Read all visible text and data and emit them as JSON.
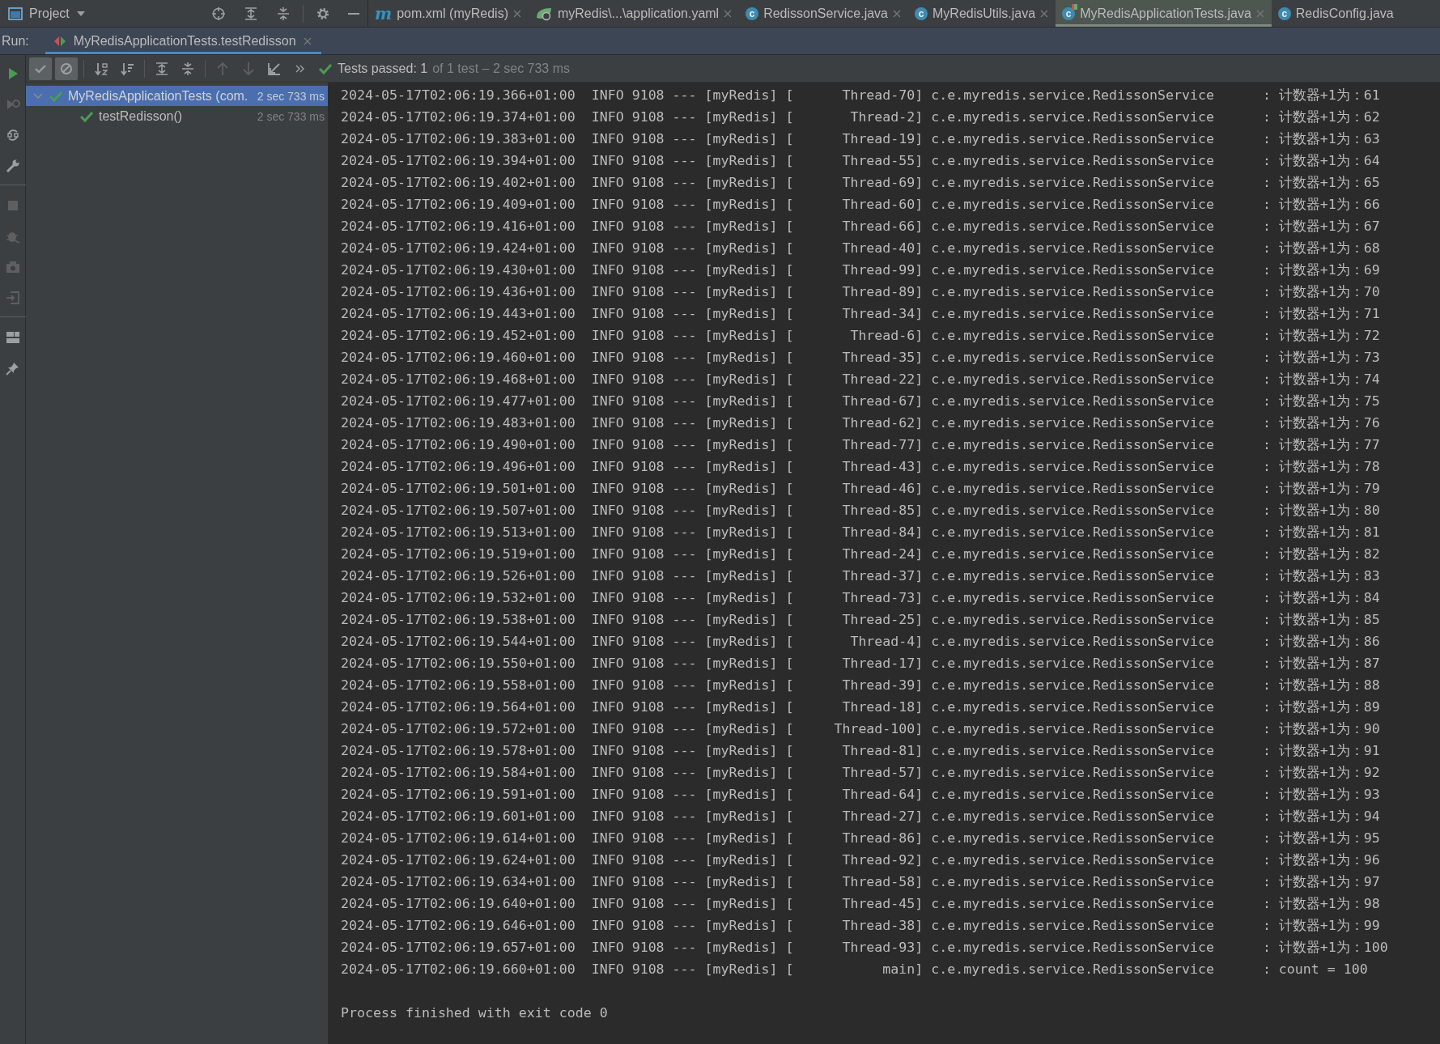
{
  "project_panel": {
    "title": "Project",
    "tools": [
      {
        "kind": "locate"
      },
      {
        "kind": "expand-all"
      },
      {
        "kind": "collapse-all"
      },
      {
        "kind": "settings"
      },
      {
        "kind": "minimize"
      }
    ]
  },
  "editor_tabs": [
    {
      "label": "pom.xml (myRedis)",
      "kind": "maven",
      "badge": "m",
      "selected": false
    },
    {
      "label": "myRedis\\...\\application.yaml",
      "kind": "spring",
      "selected": false
    },
    {
      "label": "RedissonService.java",
      "kind": "class",
      "badge": "c",
      "selected": false
    },
    {
      "label": "MyRedisUtils.java",
      "kind": "class",
      "badge": "c",
      "selected": false
    },
    {
      "label": "MyRedisApplicationTests.java",
      "kind": "test-class",
      "badge": "c",
      "selected": true
    },
    {
      "label": "RedisConfig.java",
      "kind": "class",
      "badge": "c",
      "selected": false
    }
  ],
  "run_bar": {
    "label": "Run:",
    "tab": {
      "label": "MyRedisApplicationTests.testRedisson",
      "selected": true
    }
  },
  "side_strip": [
    {
      "kind": "run",
      "disabled": false,
      "separator_before": false
    },
    {
      "kind": "rerun-failed",
      "disabled": true,
      "separator_before": false
    },
    {
      "kind": "toggle-auto",
      "disabled": false,
      "separator_before": false
    },
    {
      "kind": "wrench",
      "disabled": false,
      "separator_before": false
    },
    {
      "kind": "stop",
      "disabled": true,
      "separator_before": true
    },
    {
      "kind": "debug",
      "disabled": true,
      "separator_before": false
    },
    {
      "kind": "camera",
      "disabled": true,
      "separator_before": false
    },
    {
      "kind": "exit",
      "disabled": true,
      "separator_before": false
    },
    {
      "kind": "layout",
      "disabled": false,
      "separator_before": true
    },
    {
      "kind": "pin",
      "disabled": false,
      "separator_before": false
    }
  ],
  "toolbar": {
    "buttons": [
      {
        "kind": "show-passed",
        "selected": true,
        "disabled": false
      },
      {
        "kind": "show-ignored",
        "selected": true,
        "disabled": false
      },
      {
        "kind": "sort-alpha",
        "selected": false,
        "disabled": false
      },
      {
        "kind": "sort-duration",
        "selected": false,
        "disabled": false
      },
      {
        "kind": "expand-all",
        "selected": false,
        "disabled": false
      },
      {
        "kind": "collapse-all",
        "selected": false,
        "disabled": false
      },
      {
        "kind": "previous",
        "selected": false,
        "disabled": true
      },
      {
        "kind": "next",
        "selected": false,
        "disabled": true
      },
      {
        "kind": "import",
        "selected": false,
        "disabled": false
      },
      {
        "kind": "more",
        "selected": false,
        "disabled": false
      }
    ],
    "status": {
      "passed": true,
      "summary": "Tests passed: 1",
      "detail": "of 1 test – 2 sec 733 ms"
    }
  },
  "test_tree": [
    {
      "label": "MyRedisApplicationTests (com.",
      "duration": "2 sec 733 ms",
      "passed": true,
      "expanded": true,
      "selected": true,
      "children": [
        {
          "label": "testRedisson()",
          "duration": "2 sec 733 ms",
          "passed": true,
          "selected": false
        }
      ]
    }
  ],
  "console": {
    "lines": [
      "2024-05-17T02:06:19.366+01:00  INFO 9108 --- [myRedis] [      Thread-70] c.e.myredis.service.RedissonService      : 计数器+1为：61",
      "2024-05-17T02:06:19.374+01:00  INFO 9108 --- [myRedis] [       Thread-2] c.e.myredis.service.RedissonService      : 计数器+1为：62",
      "2024-05-17T02:06:19.383+01:00  INFO 9108 --- [myRedis] [      Thread-19] c.e.myredis.service.RedissonService      : 计数器+1为：63",
      "2024-05-17T02:06:19.394+01:00  INFO 9108 --- [myRedis] [      Thread-55] c.e.myredis.service.RedissonService      : 计数器+1为：64",
      "2024-05-17T02:06:19.402+01:00  INFO 9108 --- [myRedis] [      Thread-69] c.e.myredis.service.RedissonService      : 计数器+1为：65",
      "2024-05-17T02:06:19.409+01:00  INFO 9108 --- [myRedis] [      Thread-60] c.e.myredis.service.RedissonService      : 计数器+1为：66",
      "2024-05-17T02:06:19.416+01:00  INFO 9108 --- [myRedis] [      Thread-66] c.e.myredis.service.RedissonService      : 计数器+1为：67",
      "2024-05-17T02:06:19.424+01:00  INFO 9108 --- [myRedis] [      Thread-40] c.e.myredis.service.RedissonService      : 计数器+1为：68",
      "2024-05-17T02:06:19.430+01:00  INFO 9108 --- [myRedis] [      Thread-99] c.e.myredis.service.RedissonService      : 计数器+1为：69",
      "2024-05-17T02:06:19.436+01:00  INFO 9108 --- [myRedis] [      Thread-89] c.e.myredis.service.RedissonService      : 计数器+1为：70",
      "2024-05-17T02:06:19.443+01:00  INFO 9108 --- [myRedis] [      Thread-34] c.e.myredis.service.RedissonService      : 计数器+1为：71",
      "2024-05-17T02:06:19.452+01:00  INFO 9108 --- [myRedis] [       Thread-6] c.e.myredis.service.RedissonService      : 计数器+1为：72",
      "2024-05-17T02:06:19.460+01:00  INFO 9108 --- [myRedis] [      Thread-35] c.e.myredis.service.RedissonService      : 计数器+1为：73",
      "2024-05-17T02:06:19.468+01:00  INFO 9108 --- [myRedis] [      Thread-22] c.e.myredis.service.RedissonService      : 计数器+1为：74",
      "2024-05-17T02:06:19.477+01:00  INFO 9108 --- [myRedis] [      Thread-67] c.e.myredis.service.RedissonService      : 计数器+1为：75",
      "2024-05-17T02:06:19.483+01:00  INFO 9108 --- [myRedis] [      Thread-62] c.e.myredis.service.RedissonService      : 计数器+1为：76",
      "2024-05-17T02:06:19.490+01:00  INFO 9108 --- [myRedis] [      Thread-77] c.e.myredis.service.RedissonService      : 计数器+1为：77",
      "2024-05-17T02:06:19.496+01:00  INFO 9108 --- [myRedis] [      Thread-43] c.e.myredis.service.RedissonService      : 计数器+1为：78",
      "2024-05-17T02:06:19.501+01:00  INFO 9108 --- [myRedis] [      Thread-46] c.e.myredis.service.RedissonService      : 计数器+1为：79",
      "2024-05-17T02:06:19.507+01:00  INFO 9108 --- [myRedis] [      Thread-85] c.e.myredis.service.RedissonService      : 计数器+1为：80",
      "2024-05-17T02:06:19.513+01:00  INFO 9108 --- [myRedis] [      Thread-84] c.e.myredis.service.RedissonService      : 计数器+1为：81",
      "2024-05-17T02:06:19.519+01:00  INFO 9108 --- [myRedis] [      Thread-24] c.e.myredis.service.RedissonService      : 计数器+1为：82",
      "2024-05-17T02:06:19.526+01:00  INFO 9108 --- [myRedis] [      Thread-37] c.e.myredis.service.RedissonService      : 计数器+1为：83",
      "2024-05-17T02:06:19.532+01:00  INFO 9108 --- [myRedis] [      Thread-73] c.e.myredis.service.RedissonService      : 计数器+1为：84",
      "2024-05-17T02:06:19.538+01:00  INFO 9108 --- [myRedis] [      Thread-25] c.e.myredis.service.RedissonService      : 计数器+1为：85",
      "2024-05-17T02:06:19.544+01:00  INFO 9108 --- [myRedis] [       Thread-4] c.e.myredis.service.RedissonService      : 计数器+1为：86",
      "2024-05-17T02:06:19.550+01:00  INFO 9108 --- [myRedis] [      Thread-17] c.e.myredis.service.RedissonService      : 计数器+1为：87",
      "2024-05-17T02:06:19.558+01:00  INFO 9108 --- [myRedis] [      Thread-39] c.e.myredis.service.RedissonService      : 计数器+1为：88",
      "2024-05-17T02:06:19.564+01:00  INFO 9108 --- [myRedis] [      Thread-18] c.e.myredis.service.RedissonService      : 计数器+1为：89",
      "2024-05-17T02:06:19.572+01:00  INFO 9108 --- [myRedis] [     Thread-100] c.e.myredis.service.RedissonService      : 计数器+1为：90",
      "2024-05-17T02:06:19.578+01:00  INFO 9108 --- [myRedis] [      Thread-81] c.e.myredis.service.RedissonService      : 计数器+1为：91",
      "2024-05-17T02:06:19.584+01:00  INFO 9108 --- [myRedis] [      Thread-57] c.e.myredis.service.RedissonService      : 计数器+1为：92",
      "2024-05-17T02:06:19.591+01:00  INFO 9108 --- [myRedis] [      Thread-64] c.e.myredis.service.RedissonService      : 计数器+1为：93",
      "2024-05-17T02:06:19.601+01:00  INFO 9108 --- [myRedis] [      Thread-27] c.e.myredis.service.RedissonService      : 计数器+1为：94",
      "2024-05-17T02:06:19.614+01:00  INFO 9108 --- [myRedis] [      Thread-86] c.e.myredis.service.RedissonService      : 计数器+1为：95",
      "2024-05-17T02:06:19.624+01:00  INFO 9108 --- [myRedis] [      Thread-92] c.e.myredis.service.RedissonService      : 计数器+1为：96",
      "2024-05-17T02:06:19.634+01:00  INFO 9108 --- [myRedis] [      Thread-58] c.e.myredis.service.RedissonService      : 计数器+1为：97",
      "2024-05-17T02:06:19.640+01:00  INFO 9108 --- [myRedis] [      Thread-45] c.e.myredis.service.RedissonService      : 计数器+1为：98",
      "2024-05-17T02:06:19.646+01:00  INFO 9108 --- [myRedis] [      Thread-38] c.e.myredis.service.RedissonService      : 计数器+1为：99",
      "2024-05-17T02:06:19.657+01:00  INFO 9108 --- [myRedis] [      Thread-93] c.e.myredis.service.RedissonService      : 计数器+1为：100",
      "2024-05-17T02:06:19.660+01:00  INFO 9108 --- [myRedis] [           main] c.e.myredis.service.RedissonService      : count = 100"
    ],
    "footer": "Process finished with exit code 0"
  }
}
